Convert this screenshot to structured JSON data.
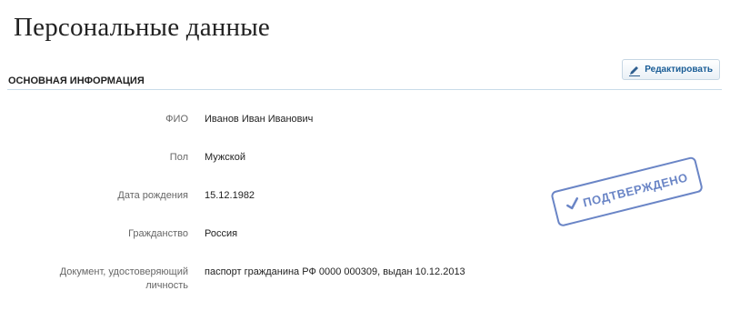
{
  "page": {
    "title": "Персональные данные"
  },
  "section": {
    "title": "ОСНОВНАЯ ИНФОРМАЦИЯ",
    "edit_label": "Редактировать"
  },
  "fields": [
    {
      "label": "ФИО",
      "value": "Иванов Иван Иванович"
    },
    {
      "label": "Пол",
      "value": "Мужской"
    },
    {
      "label": "Дата рождения",
      "value": "15.12.1982"
    },
    {
      "label": "Гражданство",
      "value": "Россия"
    },
    {
      "label_line1": "Документ, удостоверяющий",
      "label_line2": "личность",
      "value": "паспорт гражданина РФ 0000 000309, выдан 10.12.2013"
    }
  ],
  "stamp": {
    "text": "ПОДТВЕРЖДЕНО",
    "icon": "checkmark-icon",
    "color": "#5a78c0"
  },
  "colors": {
    "link": "#1a5d96",
    "divider": "#c9dce9"
  }
}
